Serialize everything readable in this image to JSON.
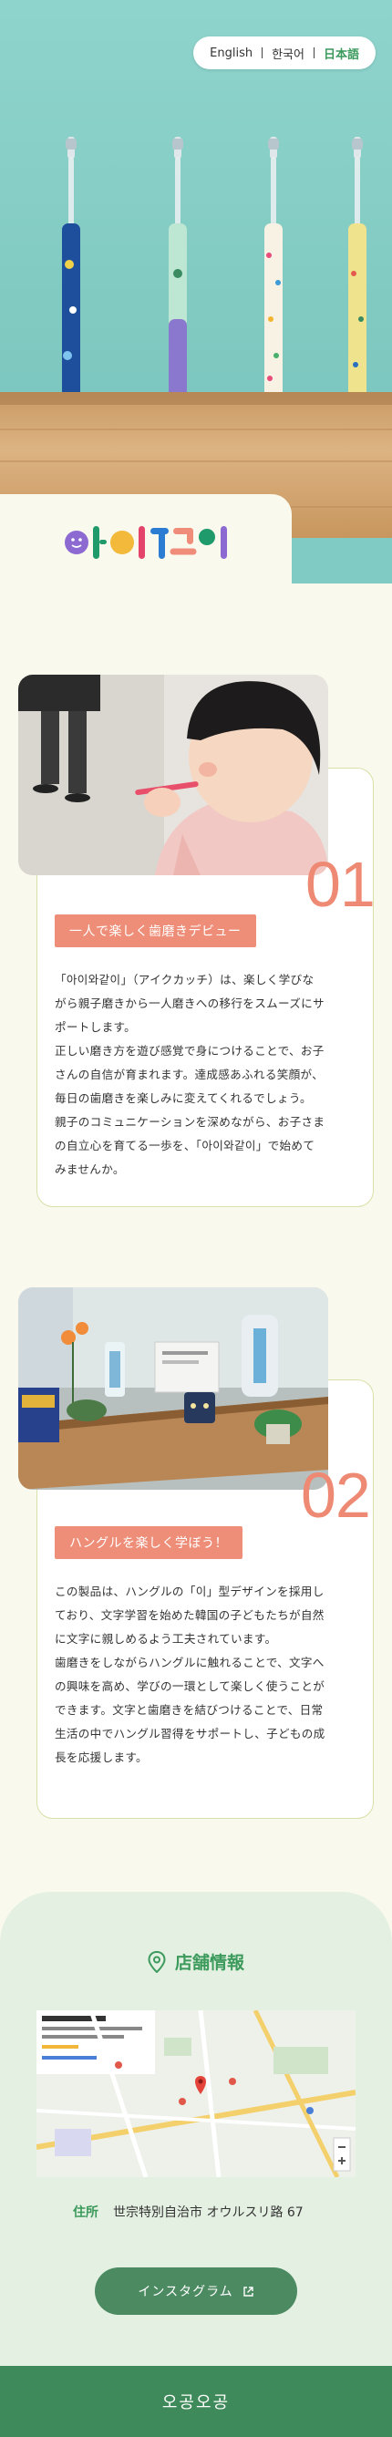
{
  "languages": {
    "english": "English",
    "korean": "한국어",
    "japanese": "日本語",
    "active": "japanese"
  },
  "logo_text": "아이와같이",
  "sections": [
    {
      "number": "01",
      "tag": "一人で楽しく歯磨きデビュー",
      "paragraphs": [
        "「아이와같이」（アイクカッチ）は、楽しく学びな",
        "がら親子磨きから一人磨きへの移行をスムーズにサ",
        "ポートします。",
        "正しい磨き方を遊び感覚で身につけることで、お子",
        "さんの自信が育まれます。達成感あふれる笑顔が、",
        "毎日の歯磨きを楽しみに変えてくれるでしょう。",
        "親子のコミュニケーションを深めながら、お子さま",
        "の自立心を育てる一歩を、「아이와같이」で始めて",
        "みませんか。"
      ]
    },
    {
      "number": "02",
      "tag": "ハングルを楽しく学ぼう！",
      "paragraphs": [
        "この製品は、ハングルの「이」型デザインを採用し",
        "ており、文字学習を始めた韓国の子どもたちが自然",
        "に文字に親しめるよう工夫されています。",
        "歯磨きをしながらハングルに触れることで、文字へ",
        "の興味を高め、学びの一環として楽しく使うことが",
        "できます。文字と歯磨きを結びつけることで、日常",
        "生活の中でハングル習得をサポートし、子どもの成",
        "長を応援します。"
      ]
    }
  ],
  "store": {
    "title": "店舗情報",
    "address_label": "住所",
    "address_value": "世宗特別自治市 オウルスリ路 67",
    "instagram_button": "インスタグラム"
  },
  "footer_text": "오공오공",
  "colors": {
    "accent_green": "#3c9a5c",
    "accent_coral": "#ef8e78",
    "hero_wall": "#80ccc4",
    "page_bg": "#f9f9ee",
    "store_bg": "#e4f1e2",
    "footer_bg": "#3f8a5a"
  }
}
